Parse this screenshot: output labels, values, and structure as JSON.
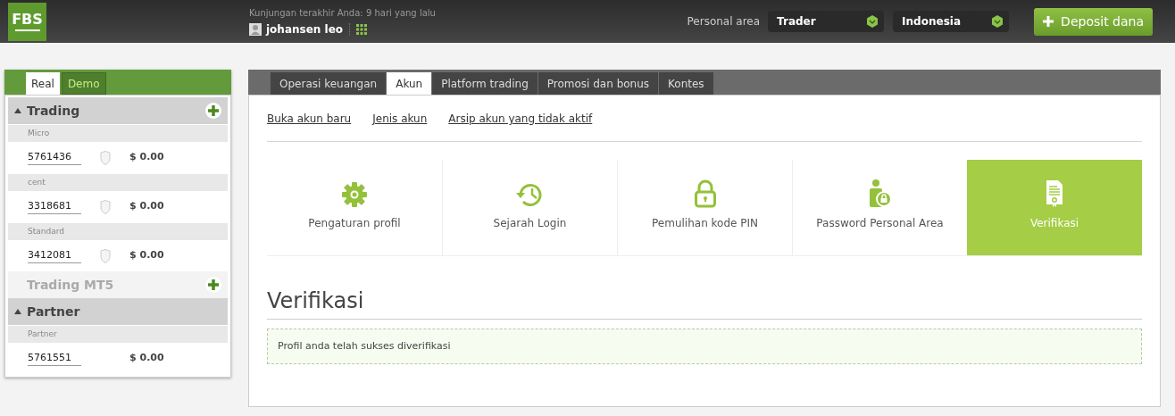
{
  "header": {
    "logo": "FBS",
    "last_visit": "Kunjungan terakhir Anda: 9 hari yang lalu",
    "user_name": "johansen leo",
    "personal_area_label": "Personal area",
    "selects": [
      {
        "value": "Trader"
      },
      {
        "value": "Indonesia"
      }
    ],
    "deposit_button": "Deposit dana"
  },
  "sidebar": {
    "tabs": [
      {
        "label": "Real",
        "selected": true
      },
      {
        "label": "Demo",
        "selected": false
      }
    ],
    "sections": [
      {
        "title": "Trading",
        "expanded": true,
        "add": true,
        "groups": [
          {
            "label": "Micro",
            "accounts": [
              {
                "number": "5761436",
                "shield": true,
                "balance": "$ 0.00"
              }
            ]
          },
          {
            "label": "cent",
            "accounts": [
              {
                "number": "3318681",
                "shield": true,
                "balance": "$ 0.00"
              }
            ]
          },
          {
            "label": "Standard",
            "accounts": [
              {
                "number": "3412081",
                "shield": true,
                "balance": "$ 0.00"
              }
            ]
          }
        ]
      },
      {
        "title": "Trading MT5",
        "expanded": false,
        "add": true
      },
      {
        "title": "Partner",
        "expanded": true,
        "add": false,
        "groups": [
          {
            "label": "Partner",
            "accounts": [
              {
                "number": "5761551",
                "shield": false,
                "balance": "$ 0.00"
              }
            ]
          }
        ]
      }
    ]
  },
  "main": {
    "tabs": [
      {
        "label": "Operasi keuangan",
        "selected": false
      },
      {
        "label": "Akun",
        "selected": true
      },
      {
        "label": "Platform trading",
        "selected": false
      },
      {
        "label": "Promosi dan bonus",
        "selected": false
      },
      {
        "label": "Kontes",
        "selected": false
      }
    ],
    "links": [
      "Buka akun baru",
      "Jenis akun",
      "Arsip akun yang tidak aktif"
    ],
    "tiles": [
      {
        "kind": "gear",
        "label": "Pengaturan profil",
        "selected": false
      },
      {
        "kind": "history",
        "label": "Sejarah Login",
        "selected": false
      },
      {
        "kind": "lock",
        "label": "Pemulihan kode PIN",
        "selected": false
      },
      {
        "kind": "userlock",
        "label": "Password Personal Area",
        "selected": false
      },
      {
        "kind": "document",
        "label": "Verifikasi",
        "selected": true
      }
    ],
    "heading": "Verifikasi",
    "message": "Profil anda telah sukses diverifikasi"
  }
}
